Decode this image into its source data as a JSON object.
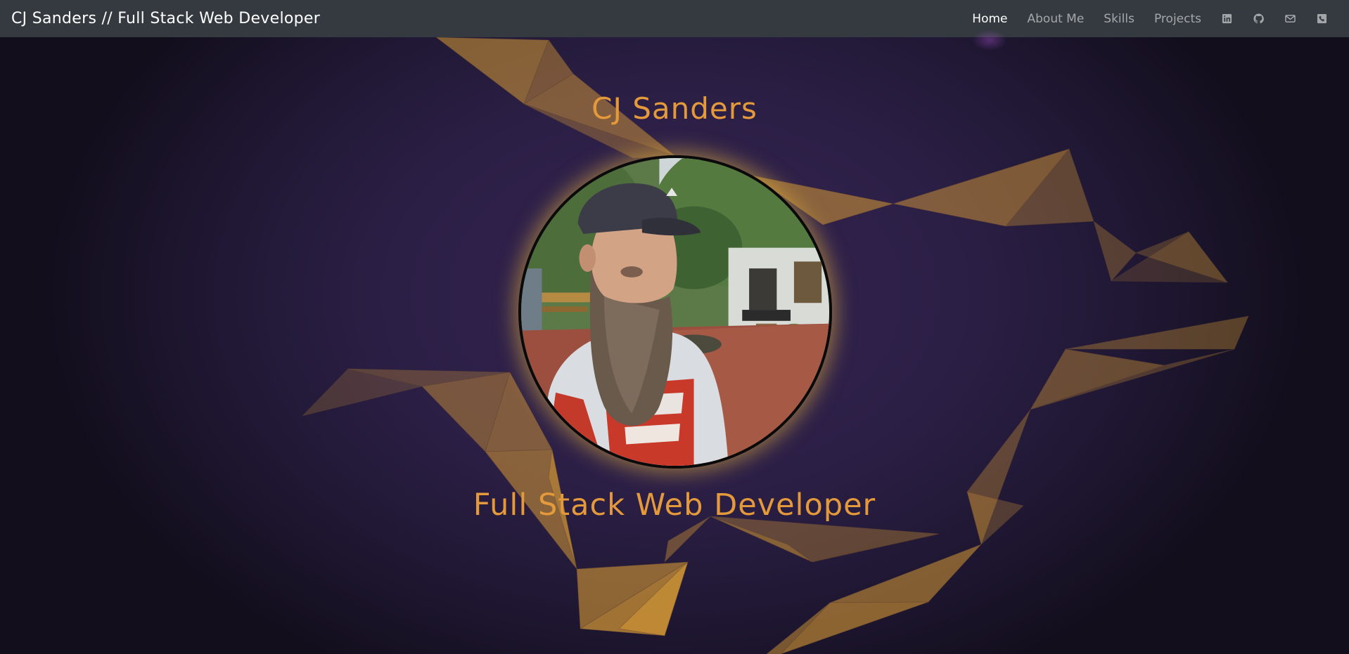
{
  "navbar": {
    "brand": "CJ Sanders // Full Stack Web Developer",
    "links": [
      {
        "label": "Home",
        "active": true
      },
      {
        "label": "About Me",
        "active": false
      },
      {
        "label": "Skills",
        "active": false
      },
      {
        "label": "Projects",
        "active": false
      }
    ],
    "icons": [
      "linkedin-icon",
      "github-icon",
      "envelope-icon",
      "phone-icon"
    ]
  },
  "hero": {
    "name": "CJ Sanders",
    "title": "Full Stack Web Developer",
    "avatar_alt": "Portrait photo"
  },
  "colors": {
    "navbar_bg": "#343a40",
    "accent_orange": "#e49a3a",
    "background_purple": "#2c1f46",
    "ribbon_gold": "#d79a35"
  }
}
